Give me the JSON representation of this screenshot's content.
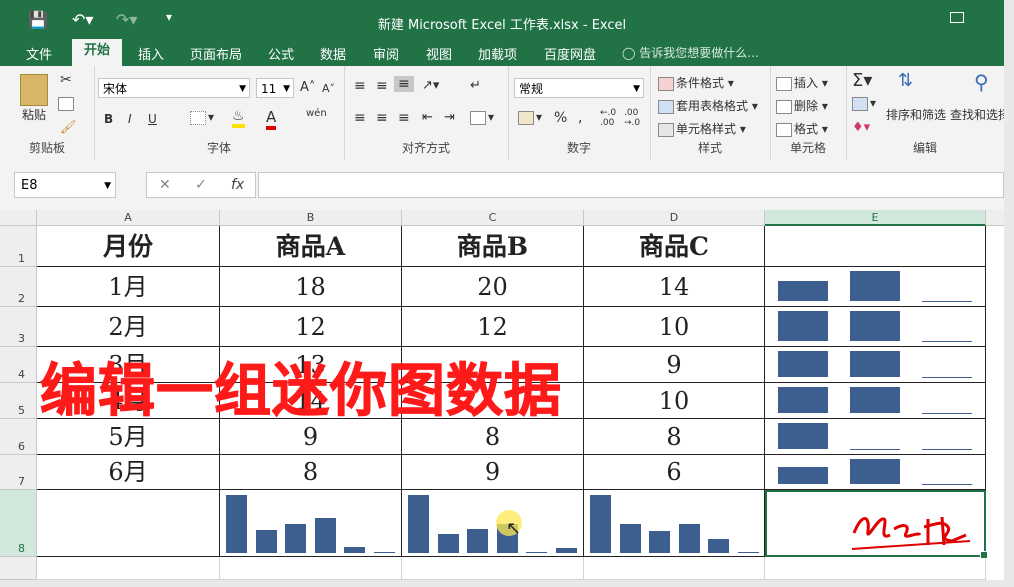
{
  "window": {
    "title": "新建 Microsoft Excel 工作表.xlsx - Excel"
  },
  "tabs": [
    "文件",
    "开始",
    "插入",
    "页面布局",
    "公式",
    "数据",
    "审阅",
    "视图",
    "加载项",
    "百度网盘"
  ],
  "tell_me": "告诉我您想要做什么...",
  "ribbon": {
    "clipboard": {
      "label": "剪贴板",
      "paste": "粘贴"
    },
    "font": {
      "label": "字体",
      "name": "宋体",
      "size": "11",
      "bold": "B",
      "italic": "I",
      "underline": "U",
      "pinyin": "wén"
    },
    "align": {
      "label": "对齐方式"
    },
    "number": {
      "label": "数字",
      "format": "常规",
      "percent": "%"
    },
    "styles": {
      "label": "样式",
      "cond": "条件格式",
      "table": "套用表格格式",
      "cell": "单元格样式"
    },
    "cells": {
      "label": "单元格",
      "insert": "插入",
      "delete": "删除",
      "format": "格式"
    },
    "editing": {
      "label": "编辑",
      "sort": "排序和筛选",
      "find": "查找和选择"
    }
  },
  "name_box": "E8",
  "columns": [
    "A",
    "B",
    "C",
    "D",
    "E"
  ],
  "rows": [
    "1",
    "2",
    "3",
    "4",
    "5",
    "6",
    "7",
    "8"
  ],
  "table": {
    "header": [
      "月份",
      "商品A",
      "商品B",
      "商品C"
    ],
    "data": [
      [
        "1月",
        "18",
        "20",
        "14"
      ],
      [
        "2月",
        "12",
        "12",
        "10"
      ],
      [
        "3月",
        "13",
        "",
        "9"
      ],
      [
        "4月",
        "14",
        "",
        "10"
      ],
      [
        "5月",
        "9",
        "8",
        "8"
      ],
      [
        "6月",
        "8",
        "9",
        "6"
      ]
    ]
  },
  "chart_data": {
    "type": "bar",
    "categories": [
      "1月",
      "2月",
      "3月",
      "4月",
      "5月",
      "6月"
    ],
    "series": [
      {
        "name": "商品A",
        "values": [
          18,
          12,
          13,
          14,
          9,
          8
        ]
      },
      {
        "name": "商品B",
        "values": [
          20,
          12,
          13,
          14,
          8,
          9
        ]
      },
      {
        "name": "商品C",
        "values": [
          14,
          10,
          9,
          10,
          8,
          6
        ]
      }
    ]
  },
  "overlay_text": "编辑一组迷你图数据",
  "colors": {
    "accent": "#217346",
    "sparkline": "#3d5f8f",
    "overlay": "#ff1a1a"
  }
}
